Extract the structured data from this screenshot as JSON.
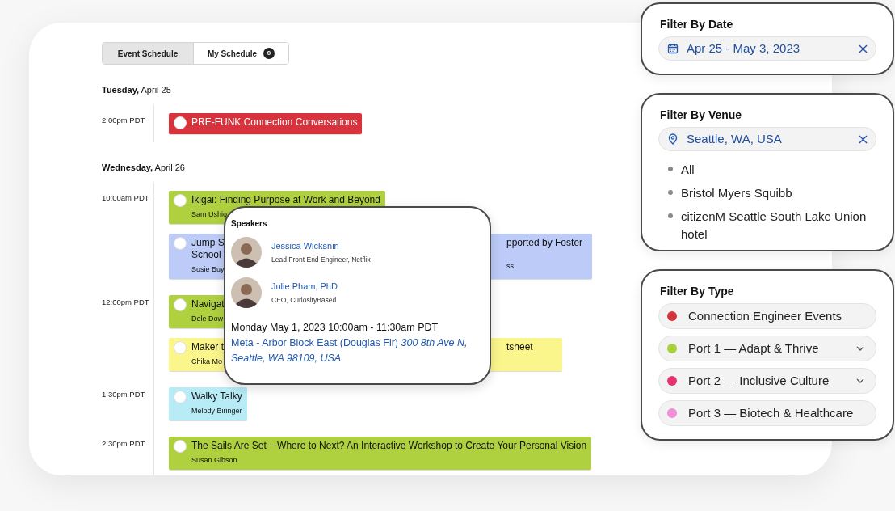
{
  "tabs": [
    {
      "label": "Event Schedule",
      "selected": true
    },
    {
      "label": "My Schedule",
      "selected": false,
      "count": "0"
    }
  ],
  "days": [
    {
      "heading": "**Tuesday,** April 25",
      "slots": [
        {
          "time": "2:00pm PDT",
          "events": [
            {
              "title": "PRE-FUNK Connection Conversations",
              "color": "#d8323c",
              "added": false
            }
          ]
        }
      ]
    },
    {
      "heading": "**Wednesday,** April 26",
      "slots": [
        {
          "time": "10:00am PDT",
          "events": [
            {
              "title": "Ikigai: Finding Purpose at Work and Beyond",
              "speaker": "Sam Ushio",
              "color": "#afd13f",
              "added": false
            },
            {
              "title": "Jump S School",
              "speaker": "Susie Buy",
              "title_tail": "pported by Foster",
              "speaker_tail": "ss",
              "color": "#bccbf7",
              "added": false
            }
          ]
        },
        {
          "time": "12:00pm PDT",
          "events": [
            {
              "title": "Navigat",
              "speaker": "Dele Dow",
              "color": "#afd13f",
              "added": false
            },
            {
              "title": "Maker t",
              "speaker": "Chika Mo",
              "title_tail": "tsheet",
              "color": "#fbf68c",
              "added": false
            }
          ]
        },
        {
          "time": "1:30pm PDT",
          "events": [
            {
              "title": "Walky Talky",
              "speaker": "Melody Biringer",
              "color": "#b7ebf5",
              "added": false
            }
          ]
        },
        {
          "time": "2:30pm PDT",
          "events": [
            {
              "title": "The Sails Are Set – Where to Next? An Interactive Workshop to Create Your Personal Vision",
              "speaker": "Susan Gibson",
              "color": "#afd13f",
              "added": false
            }
          ]
        }
      ]
    }
  ],
  "popover": {
    "heading": "Speakers",
    "speakers": [
      {
        "name": "Jessica Wicksnin",
        "role": "Lead Front End Engineer, Netflix"
      },
      {
        "name": "Julie Pham, PhD",
        "role": "CEO, CuriosityBased"
      }
    ],
    "datetime": "Monday May 1, 2023 10:00am - 11:30am PDT",
    "location": "Meta - Arbor Block East (Douglas Fir) *300 8th Ave N, Seattle, WA 98109, USA*"
  },
  "filters": {
    "date": {
      "title": "Filter By Date",
      "value": "Apr 25 - May 3, 2023"
    },
    "venue": {
      "title": "Filter By Venue",
      "value": "Seattle, WA, USA",
      "options": [
        "All",
        "Bristol Myers Squibb",
        "citizenM Seattle South Lake Union hotel"
      ]
    },
    "type": {
      "title": "Filter By Type",
      "options": [
        {
          "label": "Connection Engineer Events",
          "color": "#d8323c",
          "expandable": false
        },
        {
          "label": "Port 1 — Adapt & Thrive",
          "color": "#a6d13a",
          "expandable": true
        },
        {
          "label": "Port 2 — Inclusive Culture",
          "color": "#e83272",
          "expandable": true
        },
        {
          "label": "Port 3 — Biotech & Healthcare",
          "color": "#f08fd4",
          "expandable": false
        }
      ]
    }
  }
}
